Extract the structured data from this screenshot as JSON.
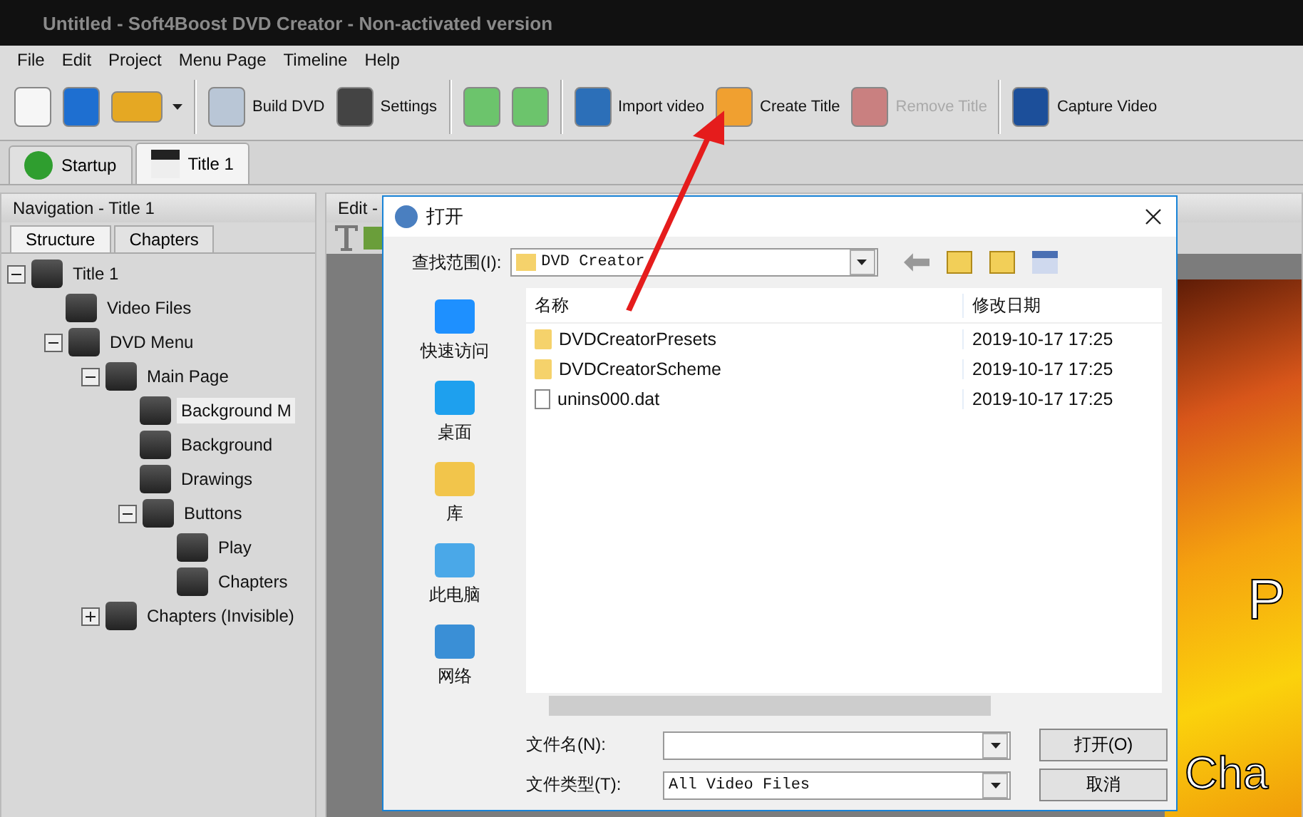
{
  "window": {
    "title": "Untitled - Soft4Boost DVD Creator - Non-activated version"
  },
  "menu": [
    "File",
    "Edit",
    "Project",
    "Menu Page",
    "Timeline",
    "Help"
  ],
  "toolbar": [
    {
      "kind": "icon"
    },
    {
      "kind": "icon"
    },
    {
      "kind": "dropdown"
    },
    {
      "kind": "separator"
    },
    {
      "kind": "labeled",
      "label": "Build DVD",
      "disabled": false
    },
    {
      "kind": "labeled",
      "label": "Settings",
      "disabled": false
    },
    {
      "kind": "separator"
    },
    {
      "kind": "icon"
    },
    {
      "kind": "icon"
    },
    {
      "kind": "separator"
    },
    {
      "kind": "labeled",
      "label": "Import video",
      "disabled": false
    },
    {
      "kind": "labeled",
      "label": "Create Title",
      "disabled": false
    },
    {
      "kind": "labeled",
      "label": "Remove Title",
      "disabled": true
    },
    {
      "kind": "separator"
    },
    {
      "kind": "labeled",
      "label": "Capture Video",
      "disabled": false
    }
  ],
  "tabs": [
    {
      "label": "Startup",
      "selected": false
    },
    {
      "label": "Title 1",
      "selected": true
    }
  ],
  "navigation": {
    "title": "Navigation - Title 1",
    "tabs": [
      {
        "label": "Structure",
        "selected": true
      },
      {
        "label": "Chapters",
        "selected": false
      }
    ],
    "tree": [
      {
        "label": "Title 1",
        "expanded": true,
        "selected": false,
        "children": [
          {
            "label": "Video Files",
            "selected": false
          },
          {
            "label": "DVD Menu",
            "expanded": true,
            "selected": false,
            "children": [
              {
                "label": "Main Page",
                "expanded": true,
                "selected": false,
                "children": [
                  {
                    "label": "Background M",
                    "selected": true
                  },
                  {
                    "label": "Background",
                    "selected": false
                  },
                  {
                    "label": "Drawings",
                    "selected": false
                  },
                  {
                    "label": "Buttons",
                    "expanded": true,
                    "selected": false,
                    "children": [
                      {
                        "label": "Play",
                        "selected": false
                      },
                      {
                        "label": "Chapters",
                        "selected": false
                      }
                    ]
                  }
                ]
              },
              {
                "label": "Chapters (Invisible)",
                "expanded": false,
                "selected": false
              }
            ]
          }
        ]
      }
    ]
  },
  "edit": {
    "title": "Edit -",
    "preview_texts": [
      "P",
      "Cha"
    ]
  },
  "dialog": {
    "title": "打开",
    "look_in_label": "查找范围(I):",
    "look_in": "DVD Creator",
    "places": [
      "快速访问",
      "桌面",
      "库",
      "此电脑",
      "网络"
    ],
    "columns": [
      "名称",
      "修改日期"
    ],
    "files": [
      {
        "kind": "folder",
        "name": "DVDCreatorPresets",
        "modified": "2019-10-17  17:25"
      },
      {
        "kind": "folder",
        "name": "DVDCreatorScheme",
        "modified": "2019-10-17  17:25"
      },
      {
        "kind": "file",
        "name": "unins000.dat",
        "modified": "2019-10-17  17:25"
      }
    ],
    "filename_label": "文件名(N):",
    "filetype_label": "文件类型(T):",
    "filetype": "All Video Files",
    "buttons": [
      "打开(O)",
      "取消"
    ]
  }
}
